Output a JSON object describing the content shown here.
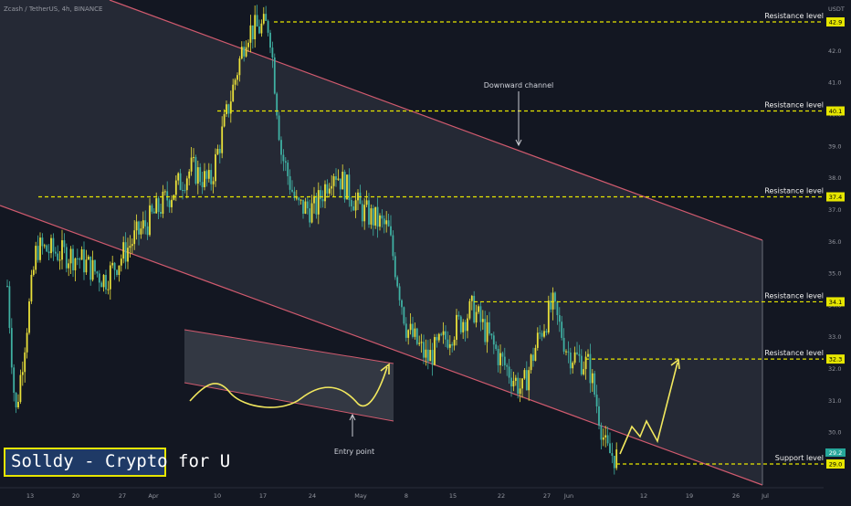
{
  "chart_data": {
    "type": "candlestick",
    "title": "Zcash / TetherUS, 4h, BINANCE",
    "y_unit": "USDT",
    "ylim": [
      28.5,
      43.3
    ],
    "y_ticks": [
      29.0,
      30.0,
      31.0,
      32.0,
      33.0,
      34.0,
      35.0,
      36.0,
      37.0,
      38.0,
      39.0,
      40.0,
      41.0,
      42.0
    ],
    "x_ticks": [
      "13",
      "20",
      "27",
      "Apr",
      "10",
      "17",
      "24",
      "May",
      "8",
      "15",
      "22",
      "27",
      "Jun",
      "12",
      "19",
      "26",
      "Jul"
    ],
    "price_path": [
      [
        "13",
        34.6
      ],
      [
        "16",
        30.5
      ],
      [
        "20",
        35.8
      ],
      [
        "23",
        35.5
      ],
      [
        "27",
        34.8
      ],
      [
        "Apr",
        36.2
      ],
      [
        "7",
        38.3
      ],
      [
        "10",
        37.8
      ],
      [
        "12",
        42.6
      ],
      [
        "17",
        42.8
      ],
      [
        "18",
        38.8
      ],
      [
        "21",
        37.1
      ],
      [
        "24",
        37.0
      ],
      [
        "27",
        38.3
      ],
      [
        "May",
        37.0
      ],
      [
        "5",
        36.4
      ],
      [
        "8",
        33.3
      ],
      [
        "12",
        32.3
      ],
      [
        "18",
        33.9
      ],
      [
        "22",
        32.3
      ],
      [
        "24",
        31.3
      ],
      [
        "27",
        33.0
      ],
      [
        "29",
        34.0
      ],
      [
        "Jun",
        32.5
      ],
      [
        "5",
        32.1
      ],
      [
        "7",
        29.4
      ],
      [
        "9",
        29.2
      ]
    ],
    "levels": [
      {
        "label": "Resistance level",
        "value": 42.9
      },
      {
        "label": "Resistance level",
        "value": 40.1
      },
      {
        "label": "Resistance level",
        "value": 37.4
      },
      {
        "label": "Resistance level",
        "value": 34.1
      },
      {
        "label": "Resistance level",
        "value": 32.3
      },
      {
        "label": "Support level",
        "value": 29.0
      }
    ],
    "last_price": 29.2,
    "annotations": [
      "Downward channel",
      "Entry point"
    ],
    "colors": {
      "up": "#e9e03a",
      "down": "#3fb0a2",
      "background": "#131722",
      "channel_border": "#d05a6e",
      "level_line": "#e6e600",
      "arrow": "#f2e85e"
    }
  },
  "watermark": "Solldy - Crypto for U"
}
